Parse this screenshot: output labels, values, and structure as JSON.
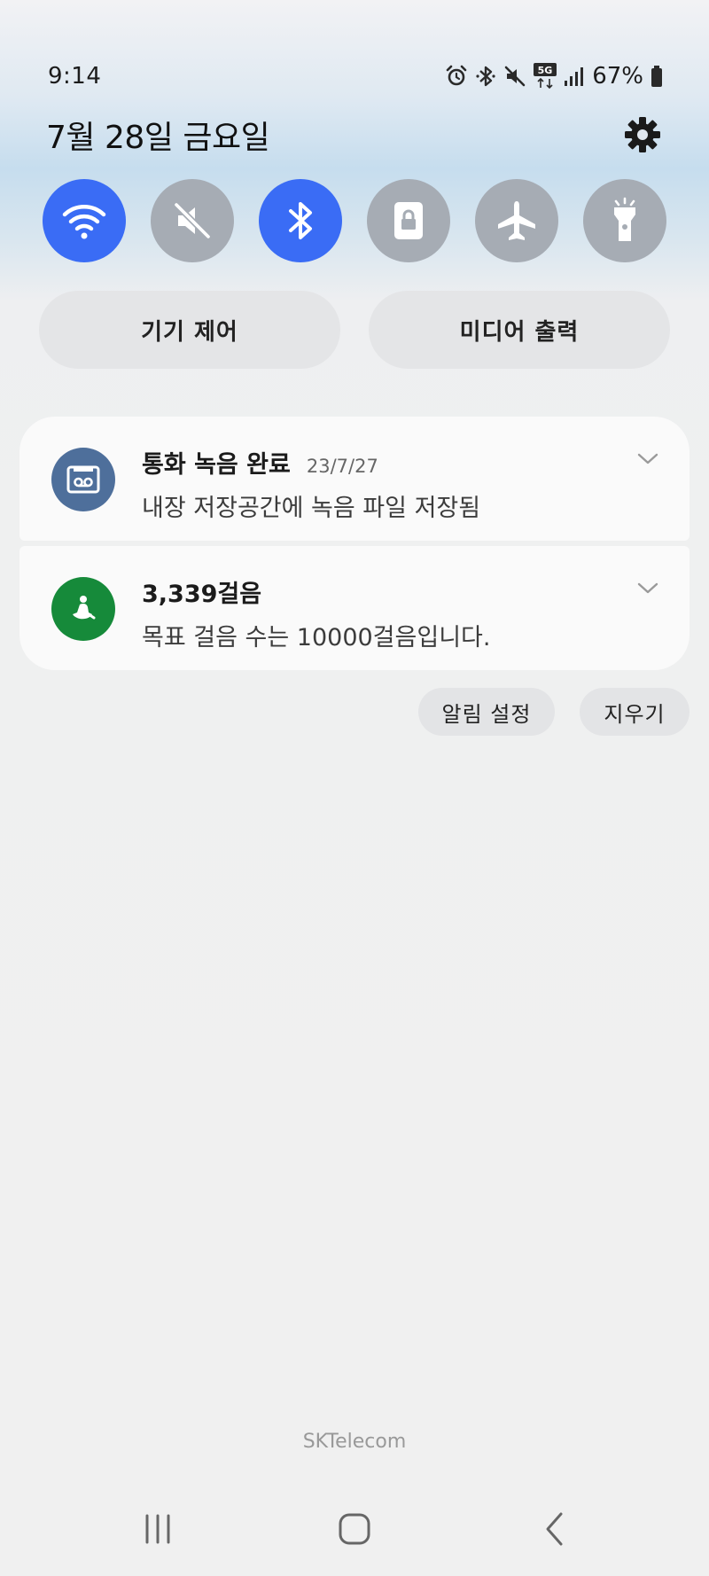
{
  "status_bar": {
    "time": "9:14",
    "network_label": "5G",
    "battery": "67%"
  },
  "header": {
    "date": "7월 28일 금요일"
  },
  "quick_tiles": [
    {
      "name": "wifi",
      "icon": "wifi-icon",
      "on": true
    },
    {
      "name": "sound",
      "icon": "mute-icon",
      "on": false
    },
    {
      "name": "bluetooth",
      "icon": "bluetooth-icon",
      "on": true
    },
    {
      "name": "rotation",
      "icon": "lock-rotation-icon",
      "on": false
    },
    {
      "name": "airplane",
      "icon": "airplane-icon",
      "on": false
    },
    {
      "name": "flashlight",
      "icon": "flashlight-icon",
      "on": false
    }
  ],
  "pills": {
    "device_control": "기기 제어",
    "media_output": "미디어 출력"
  },
  "notifications": [
    {
      "title": "통화 녹음 완료",
      "date": "23/7/27",
      "text": "내장 저장공간에 녹음 파일 저장됨",
      "icon": "voicemail-icon",
      "color": "#4e6f9b"
    },
    {
      "title": "3,339걸음",
      "text": "목표 걸음 수는 10000걸음입니다.",
      "icon": "walking-icon",
      "color": "#168a3a"
    }
  ],
  "actions": {
    "settings": "알림 설정",
    "clear": "지우기"
  },
  "carrier": "SKTelecom",
  "colors": {
    "tile_on": "#3a6cf5",
    "tile_off": "#a6acb4"
  }
}
